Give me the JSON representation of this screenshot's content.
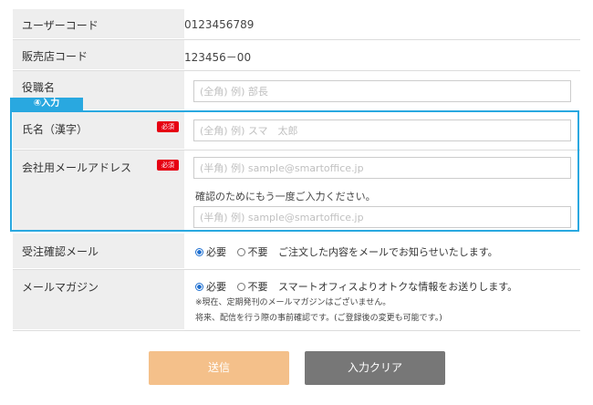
{
  "rows": {
    "user_code": {
      "label": "ユーザーコード",
      "value": "0123456789"
    },
    "store_code": {
      "label": "販売店コード",
      "value": "123456－00"
    },
    "title": {
      "label": "役職名",
      "placeholder": "(全角) 例) 部長"
    },
    "name": {
      "label": "氏名（漢字）",
      "required": "必須",
      "placeholder": "(全角) 例) スマ　太郎"
    },
    "email": {
      "label": "会社用メールアドレス",
      "required": "必須",
      "placeholder": "(半角) 例) sample@smartoffice.jp",
      "confirm_note": "確認のためにもう一度ご入力ください。",
      "confirm_placeholder": "(半角) 例) sample@smartoffice.jp"
    },
    "order_mail": {
      "label": "受注確認メール",
      "option_yes": "必要",
      "option_no": "不要",
      "selected": "必要",
      "description": "ご注文した内容をメールでお知らせいたします。"
    },
    "magazine": {
      "label": "メールマガジン",
      "option_yes": "必要",
      "option_no": "不要",
      "selected": "必要",
      "description": "スマートオフィスよりオトクな情報をお送りします。",
      "note1": "※現在、定期発刊のメールマガジンはございません。",
      "note2": "将来、配信を行う際の事前確認です。(ご登録後の変更も可能です。)"
    }
  },
  "annotation_tab": "④入力",
  "buttons": {
    "submit": "送信",
    "clear": "入力クリア"
  },
  "colors": {
    "highlight": "#29a8e0",
    "required": "#e60012",
    "submit": "#f4c08a",
    "clear": "#777777"
  }
}
